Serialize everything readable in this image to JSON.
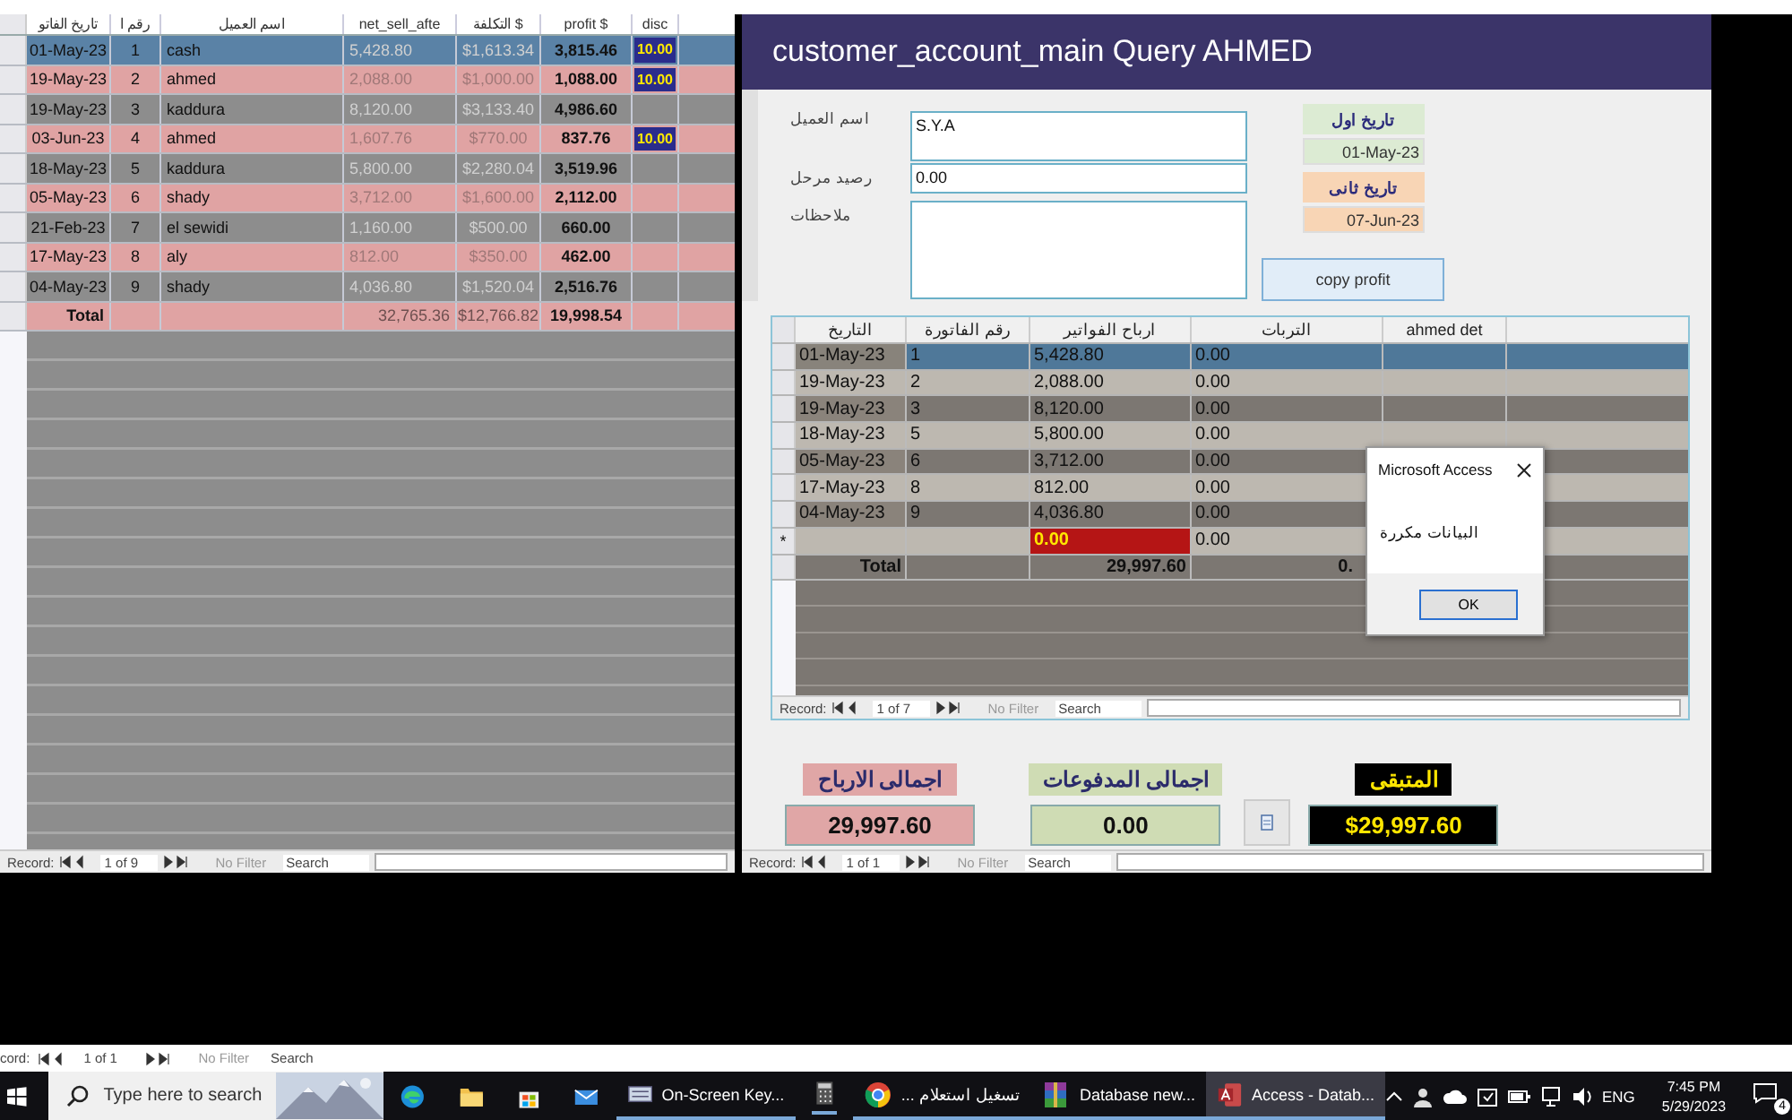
{
  "left_table": {
    "headers": {
      "date": "تاريخ الفاتو",
      "no": "رقم ا",
      "name": "اسم العميل",
      "net": "net_sell_afte",
      "cost": "التكلفة $",
      "profit": "profit $",
      "disc": "disc"
    },
    "rows": [
      {
        "date": "01-May-23",
        "no": "1",
        "name": "cash",
        "net": "5,428.80",
        "cost": "$1,613.34",
        "profit": "3,815.46",
        "disc": "10.00",
        "selected": true
      },
      {
        "date": "19-May-23",
        "no": "2",
        "name": "ahmed",
        "net": "2,088.00",
        "cost": "$1,000.00",
        "profit": "1,088.00",
        "disc": "10.00",
        "selected": false
      },
      {
        "date": "19-May-23",
        "no": "3",
        "name": "kaddura",
        "net": "8,120.00",
        "cost": "$3,133.40",
        "profit": "4,986.60",
        "selected": false
      },
      {
        "date": "03-Jun-23",
        "no": "4",
        "name": "ahmed",
        "net": "1,607.76",
        "cost": "$770.00",
        "profit": "837.76",
        "disc": "10.00",
        "selected": false
      },
      {
        "date": "18-May-23",
        "no": "5",
        "name": "kaddura",
        "net": "5,800.00",
        "cost": "$2,280.04",
        "profit": "3,519.96",
        "selected": false
      },
      {
        "date": "05-May-23",
        "no": "6",
        "name": "shady",
        "net": "3,712.00",
        "cost": "$1,600.00",
        "profit": "2,112.00",
        "selected": false
      },
      {
        "date": "21-Feb-23",
        "no": "7",
        "name": "el sewidi",
        "net": "1,160.00",
        "cost": "$500.00",
        "profit": "660.00",
        "selected": false
      },
      {
        "date": "17-May-23",
        "no": "8",
        "name": "aly",
        "net": "812.00",
        "cost": "$350.00",
        "profit": "462.00",
        "selected": false
      },
      {
        "date": "04-May-23",
        "no": "9",
        "name": "shady",
        "net": "4,036.80",
        "cost": "$1,520.04",
        "profit": "2,516.76",
        "selected": false
      }
    ],
    "total": {
      "label": "Total",
      "net": "32,765.36",
      "cost": "$12,766.82",
      "profit": "19,998.54"
    },
    "nav": {
      "label": "Record:",
      "position": "1 of 9",
      "filter": "No Filter",
      "search": "Search"
    }
  },
  "form": {
    "title": "customer_account_main Query AHMED",
    "fields": [
      {
        "label": "اسم العميل",
        "value": "S.Y.A"
      },
      {
        "label": "رصيد مرحل",
        "value": "0.00"
      },
      {
        "label": "ملاحظات"
      }
    ],
    "dates": [
      {
        "label": "تاريخ اول",
        "value": "01-May-23",
        "color": "#dcebd3"
      },
      {
        "label": "تاريخ ثانى",
        "value": "07-Jun-23",
        "color": "#f8d5b5"
      }
    ],
    "copy_button": "copy profit",
    "subform": {
      "headers": {
        "date": "التاريخ",
        "no": "رقم الفاتورة",
        "profit": "ارباح الفواتير",
        "value": "التربات",
        "column_5": "ahmed det"
      },
      "rows": [
        {
          "date": "01-May-23",
          "no": "1",
          "profit": "5,428.80",
          "value": "0.00",
          "selected": true
        },
        {
          "date": "19-May-23",
          "no": "2",
          "profit": "2,088.00",
          "value": "0.00",
          "selected": false
        },
        {
          "date": "19-May-23",
          "no": "3",
          "profit": "8,120.00",
          "value": "0.00",
          "selected": false
        },
        {
          "date": "18-May-23",
          "no": "5",
          "profit": "5,800.00",
          "value": "0.00",
          "selected": false
        },
        {
          "date": "05-May-23",
          "no": "6",
          "profit": "3,712.00",
          "value": "0.00",
          "selected": false
        },
        {
          "date": "17-May-23",
          "no": "8",
          "profit": "812.00",
          "value": "0.00",
          "selected": false
        },
        {
          "date": "04-May-23",
          "no": "9",
          "profit": "4,036.80",
          "value": "0.00",
          "selected": false
        }
      ],
      "new_row": {
        "marker": "*",
        "profit": "0.00",
        "value": "0.00"
      },
      "total": {
        "label": "Total",
        "profit": "29,997.60",
        "value": "0."
      },
      "nav": {
        "label": "Record:",
        "position": "1 of 7",
        "filter": "No Filter",
        "search": "Search"
      }
    },
    "summary": {
      "profit": {
        "label": "اجمالى الارباح",
        "value": "29,997.60"
      },
      "paid": {
        "label": "اجمالى المدفوعات",
        "value": "0.00"
      },
      "remaining": {
        "label": "المتبقى",
        "value": "$29,997.60"
      }
    },
    "nav": {
      "label": "Record:",
      "position": "1 of 1",
      "filter": "No Filter",
      "search": "Search"
    },
    "dialog": {
      "title": "Microsoft Access",
      "message": "البيانات مكررة",
      "button": "OK"
    }
  },
  "back_nav": {
    "label": "cord:",
    "position": "1 of 1",
    "filter": "No Filter",
    "search": "Search"
  },
  "taskbar": {
    "search": {
      "placeholder": "Type here to search"
    },
    "windows": [
      {
        "label": "On-Screen Key...",
        "selected": false
      },
      {
        "label": "... تسغيل استعلام",
        "selected": false
      },
      {
        "label": "Database new...",
        "selected": false
      },
      {
        "label": "Access - Datab...",
        "selected": true
      }
    ],
    "language": "ENG",
    "time": "7:45 PM",
    "date": "5/29/2023",
    "notifications": "4"
  }
}
